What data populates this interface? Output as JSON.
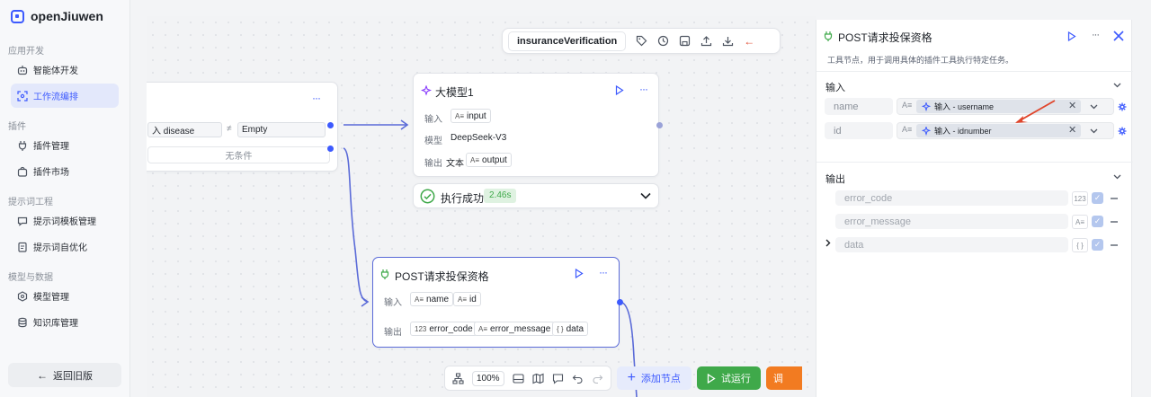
{
  "app": {
    "name": "openJiuwen"
  },
  "sidebar": {
    "sections": [
      {
        "title": "应用开发",
        "items": [
          {
            "label": "智能体开发",
            "active": false
          },
          {
            "label": "工作流编排",
            "active": true
          }
        ]
      },
      {
        "title": "插件",
        "items": [
          {
            "label": "插件管理",
            "active": false
          },
          {
            "label": "插件市场",
            "active": false
          }
        ]
      },
      {
        "title": "提示词工程",
        "items": [
          {
            "label": "提示词模板管理",
            "active": false
          },
          {
            "label": "提示词自优化",
            "active": false
          }
        ]
      },
      {
        "title": "模型与数据",
        "items": [
          {
            "label": "模型管理",
            "active": false
          },
          {
            "label": "知识库管理",
            "active": false
          }
        ]
      }
    ],
    "back_label": "返回旧版"
  },
  "workflow": {
    "name": "insuranceVerification"
  },
  "condition_node": {
    "left_value": "入 disease",
    "operator": "≠",
    "right_value": "Empty",
    "else_label": "无条件"
  },
  "llm_node": {
    "title": "大模型1",
    "input_label": "输入",
    "input_tag": "input",
    "model_label": "模型",
    "model_value": "DeepSeek-V3",
    "output_label": "输出",
    "output_type": "文本",
    "output_tag": "output",
    "status": "执行成功",
    "duration": "2.46s"
  },
  "post_node": {
    "title": "POST请求投保资格",
    "input_label": "输入",
    "inputs": [
      "name",
      "id"
    ],
    "output_label": "输出",
    "outputs": [
      {
        "type": "123",
        "name": "error_code"
      },
      {
        "type": "A≡",
        "name": "error_message"
      },
      {
        "type": "{ }",
        "name": "data"
      }
    ]
  },
  "bottom_toolbar": {
    "zoom": "100%",
    "add_node": "添加节点",
    "test_run": "试运行",
    "orange_partial": "调"
  },
  "panel": {
    "title": "POST请求投保资格",
    "description": "工具节点，用于调用具体的插件工具执行特定任务。",
    "input_section": "输入",
    "inputs": [
      {
        "name": "name",
        "value": "输入 - username"
      },
      {
        "name": "id",
        "value": "输入 - idnumber"
      }
    ],
    "output_section": "输出",
    "outputs": [
      {
        "name": "error_code",
        "type": "123"
      },
      {
        "name": "error_message",
        "type": "A≡"
      },
      {
        "name": "data",
        "type": "{ }"
      }
    ]
  },
  "colors": {
    "accent": "#3d5afe",
    "success": "#3fa94a",
    "orange": "#f27b21",
    "annotation_arrow": "#e0452b"
  }
}
